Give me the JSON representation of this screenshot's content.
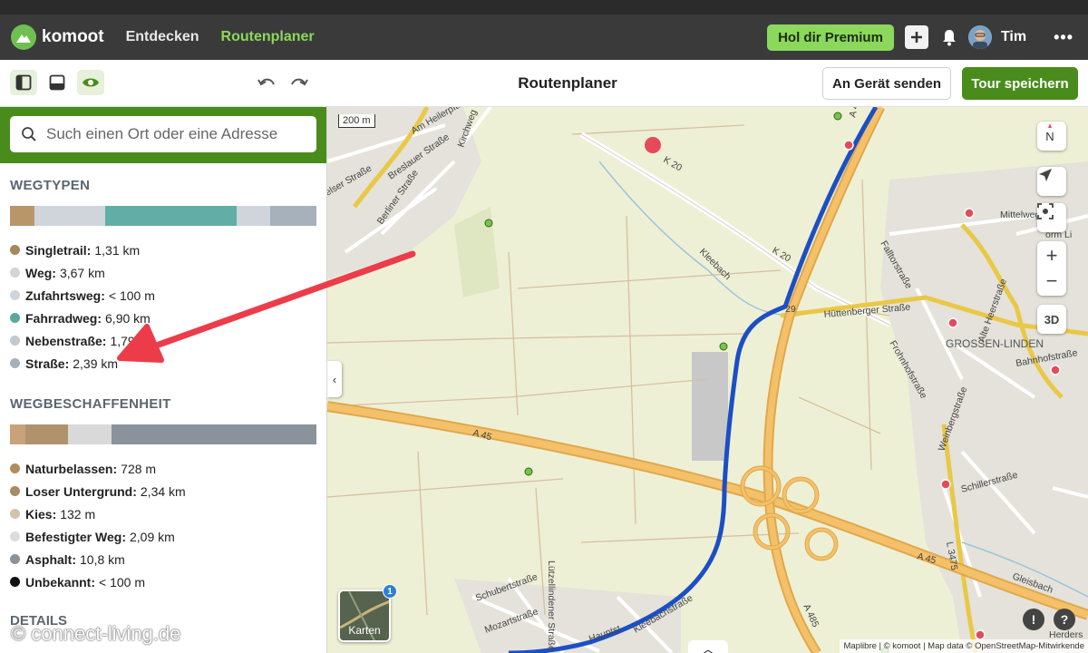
{
  "app": {
    "brand": "komoot",
    "nav": [
      {
        "label": "Entdecken",
        "active": false
      },
      {
        "label": "Routenplaner",
        "active": true
      }
    ],
    "premium_label": "Hol dir Premium",
    "user_name": "Tim",
    "more_label": "•••"
  },
  "toolbar": {
    "title": "Routenplaner",
    "send_label": "An Gerät senden",
    "save_label": "Tour speichern"
  },
  "search": {
    "placeholder": "Such einen Ort oder eine Adresse"
  },
  "wegtypen": {
    "title": "WEGTYPEN",
    "segments": [
      {
        "color": "#b8966a",
        "share": 0.08
      },
      {
        "color": "#cfd5db",
        "share": 0.23
      },
      {
        "color": "#62aea6",
        "share": 0.43
      },
      {
        "color": "#cfd5db",
        "share": 0.11
      },
      {
        "color": "#a7b1bb",
        "share": 0.15
      }
    ],
    "items": [
      {
        "name": "Singletrail:",
        "value": "1,31 km",
        "color": "#a9875d"
      },
      {
        "name": "Weg:",
        "value": "3,67 km",
        "color": "#cfd5db"
      },
      {
        "name": "Zufahrtsweg:",
        "value": "< 100 m",
        "color": "#cfd5db"
      },
      {
        "name": "Fahrradweg:",
        "value": "6,90 km",
        "color": "#5aa8a0"
      },
      {
        "name": "Nebenstraße:",
        "value": "1,79 km",
        "color": "#c4c9ce"
      },
      {
        "name": "Straße:",
        "value": "2,39 km",
        "color": "#a7b1bb"
      }
    ]
  },
  "wegbeschaffenheit": {
    "title": "WEGBESCHAFFENHEIT",
    "segments": [
      {
        "color": "#c9a27a",
        "share": 0.05
      },
      {
        "color": "#b0926c",
        "share": 0.14
      },
      {
        "color": "#d9d9d9",
        "share": 0.14
      },
      {
        "color": "#8a939c",
        "share": 0.67
      }
    ],
    "items": [
      {
        "name": "Naturbelassen:",
        "value": "728 m",
        "color": "#b48b5e"
      },
      {
        "name": "Loser Untergrund:",
        "value": "2,34 km",
        "color": "#a98a64"
      },
      {
        "name": "Kies:",
        "value": "132 m",
        "color": "#d3c2ad"
      },
      {
        "name": "Befestigter Weg:",
        "value": "2,09 km",
        "color": "#dcdcdc"
      },
      {
        "name": "Asphalt:",
        "value": "10,8 km",
        "color": "#8a939c"
      },
      {
        "name": "Unbekannt:",
        "value": "< 100 m",
        "color": "#111111"
      }
    ]
  },
  "details_title": "DETAILS",
  "map": {
    "scale": "200 m",
    "labels": [
      {
        "text": "Am Heilerpfad"
      },
      {
        "text": "Kirchweg"
      },
      {
        "text": "Breslauer Straße"
      },
      {
        "text": "Berliner Straße"
      },
      {
        "text": "elser Straße"
      },
      {
        "text": "K 20"
      },
      {
        "text": "K 20"
      },
      {
        "text": "Kleebach"
      },
      {
        "text": "Hüttenberger Straße"
      },
      {
        "text": "29"
      },
      {
        "text": "Falltorstraße"
      },
      {
        "text": "Alte Heerstraße"
      },
      {
        "text": "Mittelweg"
      },
      {
        "text": "GROSSEN-LINDEN"
      },
      {
        "text": "Frohnhofstraße"
      },
      {
        "text": "Bahnhofstraße"
      },
      {
        "text": "A 45"
      },
      {
        "text": "A 45"
      },
      {
        "text": "A 485"
      },
      {
        "text": "A 485"
      },
      {
        "text": "Schillerstraße"
      },
      {
        "text": "L 3475"
      },
      {
        "text": "Lützellindener Straße"
      },
      {
        "text": "Schubertstraße"
      },
      {
        "text": "Mozartstraße"
      },
      {
        "text": "Kleebachstraße"
      },
      {
        "text": "Hauptst"
      },
      {
        "text": "Herders"
      },
      {
        "text": "Weinbergstraße"
      },
      {
        "text": "Gleisbach"
      },
      {
        "text": "orm Li"
      }
    ],
    "compass": "N",
    "zoom_in": "+",
    "zoom_out": "−",
    "three_d": "3D",
    "karten_label": "Karten",
    "karten_badge": "1",
    "attribution": "Maplibre | © komoot | Map data © OpenStreetMap-Mitwirkende",
    "help_1": "!",
    "help_2": "?"
  },
  "watermark": "© connect-living.de"
}
